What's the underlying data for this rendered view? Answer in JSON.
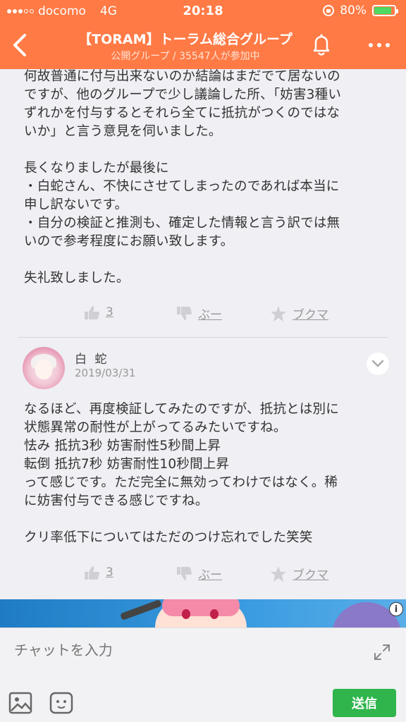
{
  "status_bar": {
    "carrier": "docomo",
    "network": "4G",
    "time": "20:18",
    "battery": "80%"
  },
  "header": {
    "title": "【TORAM】トーラム総合グループ",
    "subtitle": "公開グループ / 35547人が参加中"
  },
  "post1": {
    "body": "何故普通に付与出来ないのか結論はまだでて居ないの\nですが、他のグループで少し議論した所、「妨害3種い\nずれかを付与するとそれら全てに抵抗がつくのではな\nいか」と言う意見を伺いました。\n\n長くなりましたが最後に\n・白蛇さん、不快にさせてしまったのであれば本当に\n申し訳ないです。\n・自分の検証と推測も、確定した情報と言う訳では無\nいので参考程度にお願い致します。\n\n失礼致しました。",
    "like_count": "3",
    "dislike_label": "ぶー",
    "bookmark_label": "ブクマ"
  },
  "post2": {
    "author": "白 蛇",
    "date": "2019/03/31",
    "body": "なるほど、再度検証してみたのですが、抵抗とは別に\n状態異常の耐性が上がってるみたいですね。\n怯み 抵抗3秒 妨害耐性5秒間上昇\n転倒 抵抗7秒 妨害耐性10秒間上昇\nって感じです。ただ完全に無効ってわけではなく。稀\nに妨害付与できる感じですね。\n\nクリ率低下についてはただのつけ忘れでした笑笑",
    "like_count": "3",
    "dislike_label": "ぶー",
    "bookmark_label": "ブクマ"
  },
  "ad": {
    "info_icon": "i"
  },
  "input": {
    "placeholder": "チャットを入力",
    "send_label": "送信"
  },
  "colors": {
    "header": "#ff7a45",
    "send": "#2fb54c",
    "battery": "#4cd964"
  }
}
